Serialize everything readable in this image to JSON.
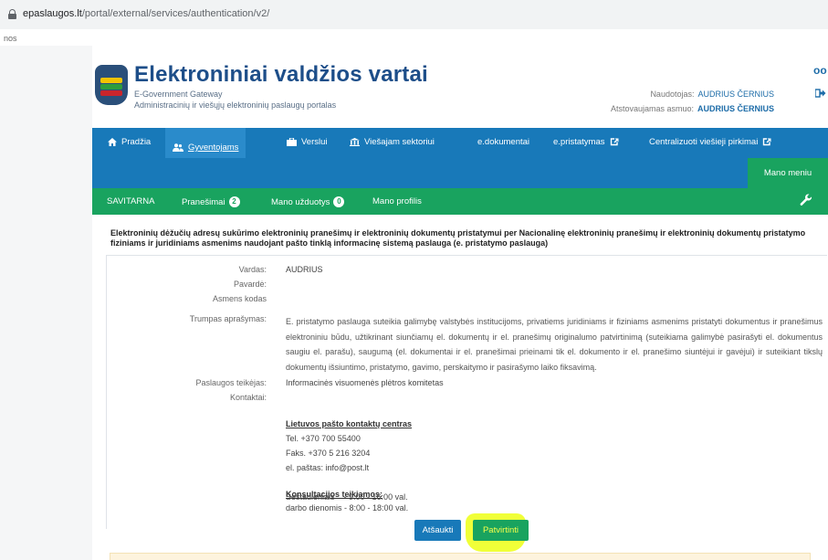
{
  "browser": {
    "url_host": "epaslaugos.lt",
    "url_path": "/portal/external/services/authentication/v2/"
  },
  "left_fragment": "nos",
  "header": {
    "title": "Elektroniniai valdžios vartai",
    "subtitle1": "E-Government Gateway",
    "subtitle2": "Administracinių ir viešųjų elektroninių paslaugų portalas",
    "user_label": "Naudotojas:",
    "user_name": "AUDRIUS ČERNIUS",
    "represented_label": "Atstovaujamas asmuo:",
    "represented_name": "AUDRIUS ČERNIUS"
  },
  "nav": {
    "items": [
      {
        "label": "Pradžia",
        "icon": "home-icon"
      },
      {
        "label": "Gyventojams",
        "icon": "people-icon",
        "active": true
      },
      {
        "label": "Verslui",
        "icon": "briefcase-icon"
      },
      {
        "label": "Viešajam sektoriui",
        "icon": "institution-icon"
      },
      {
        "label": "e.dokumentai"
      },
      {
        "label": "e.pristatymas",
        "icon": "external-link-icon"
      },
      {
        "label": "Centralizuoti viešieji pirkimai",
        "icon": "external-link-icon"
      }
    ],
    "mano_meniu": "Mano meniu"
  },
  "subnav": {
    "items": [
      {
        "label": "SAVITARNA"
      },
      {
        "label": "Pranešimai",
        "badge": "2"
      },
      {
        "label": "Mano užduotys",
        "badge": "0"
      },
      {
        "label": "Mano profilis"
      }
    ]
  },
  "service": {
    "title": "Elektroninių dėžučių adresų sukūrimo elektroninių pranešimų ir elektroninių dokumentų pristatymui per Nacionalinę elektroninių pranešimų ir elektroninių dokumentų pristatymo fiziniams ir juridiniams asmenims naudojant pašto tinklą informacinę sistemą paslauga (e. pristatymo paslauga)"
  },
  "form": {
    "vardas_label": "Vardas:",
    "vardas_value": "AUDRIUS",
    "pavarde_label": "Pavardė:",
    "asmens_kodas_label": "Asmens kodas",
    "aprasymas_label": "Trumpas aprašymas:",
    "aprasymas_value": "E. pristatymo paslauga suteikia galimybę valstybės institucijoms, privatiems juridiniams ir fiziniams asmenims pristatyti dokumentus ir pranešimus elektroniniu būdu, užtikrinant siunčiamų el. dokumentų ir el. pranešimų originalumo patvirtinimą (suteikiama galimybė pasirašyti el. dokumentus saugiu el. parašu), saugumą (el. dokumentai ir el. pranešimai prieinami tik el. dokumento ir el. pranešimo siuntėjui ir gavėjui) ir suteikiant tikslų dokumentų išsiuntimo, pristatymo, gavimo, perskaitymo ir pasirašymo laiko fiksavimą.",
    "teikejas_label": "Paslaugos teikėjas:",
    "teikejas_value": "Informacinės visuomenės plėtros komitetas",
    "kontaktai_label": "Kontaktai:",
    "contact_center_title": "Lietuvos pašto kontaktų centras",
    "tel": "Tel.  +370 700 55400",
    "fax": "Faks. +370 5 216 3204",
    "email": "el. paštas: info@post.lt",
    "consult_title": "Konsultacijos teikiamos:",
    "hours1": "darbo dienomis - 8:00 - 18:00 val.",
    "hours2": "Šeštadieniais    - 9:00 - 16:00 val."
  },
  "buttons": {
    "cancel": "Atšaukti",
    "confirm": "Patvirtinti"
  },
  "colors": {
    "nav_blue": "#1879b9",
    "green": "#19a35f",
    "title_blue": "#1d4e89",
    "highlight": "#ecff00"
  }
}
